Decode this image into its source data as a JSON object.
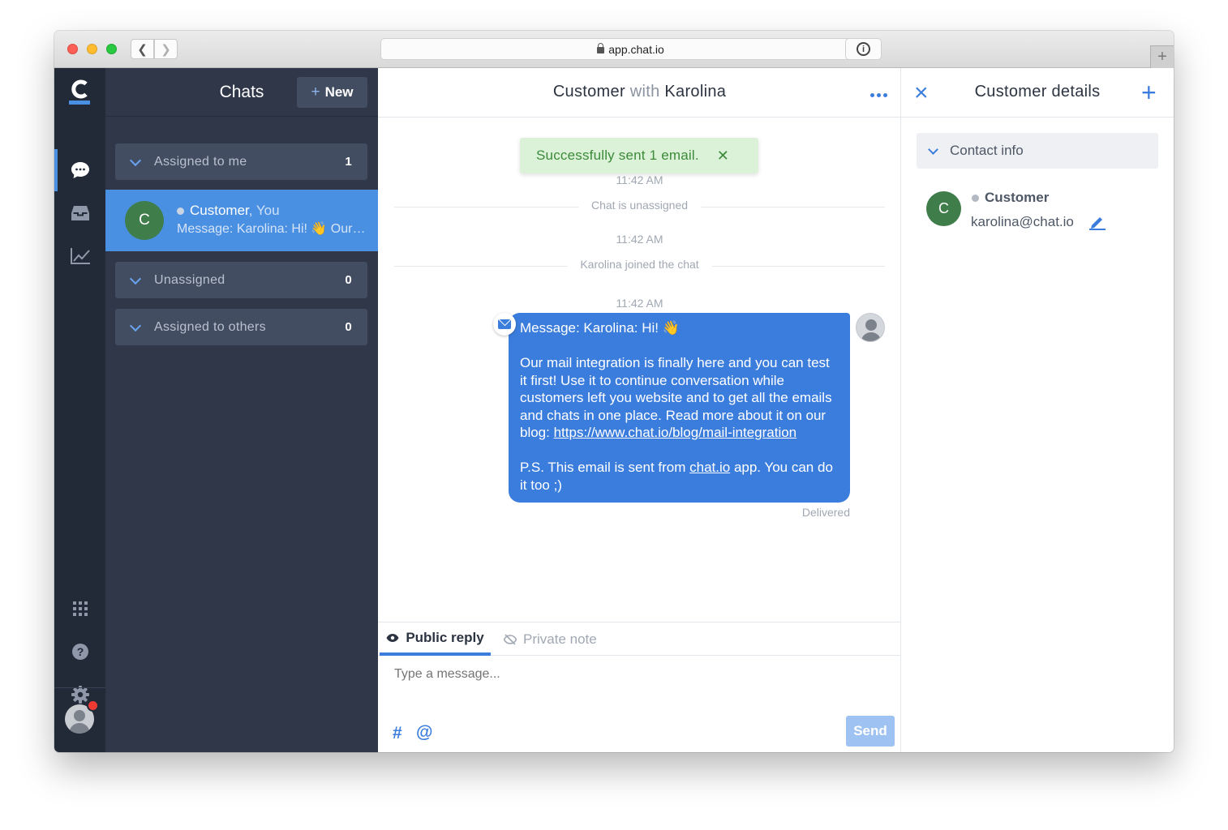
{
  "browser": {
    "url": "app.chat.io",
    "icons": [
      "back-icon",
      "forward-icon",
      "lock-icon",
      "reload-icon",
      "info-icon",
      "new-tab-icon"
    ]
  },
  "rail": {
    "items": [
      {
        "name": "chats",
        "icon": "chat-bubble-icon",
        "active": true
      },
      {
        "name": "archive",
        "icon": "inbox-icon",
        "active": false
      },
      {
        "name": "reports",
        "icon": "chart-line-icon",
        "active": false
      },
      {
        "name": "apps",
        "icon": "grid-icon",
        "active": false
      },
      {
        "name": "help",
        "icon": "question-icon",
        "active": false
      },
      {
        "name": "settings",
        "icon": "gear-icon",
        "active": false
      }
    ]
  },
  "chats_panel": {
    "title": "Chats",
    "new_button": "New",
    "groups": [
      {
        "label": "Assigned to me",
        "count": "1"
      },
      {
        "label": "Unassigned",
        "count": "0"
      },
      {
        "label": "Assigned to others",
        "count": "0"
      }
    ],
    "active_chat": {
      "avatar_initial": "C",
      "name": "Customer",
      "participants_suffix": ", You",
      "preview": "Message: Karolina: Hi! 👋 Our mail integration is finally here"
    }
  },
  "conversation": {
    "title_customer": "Customer",
    "title_with": "with",
    "title_agent": "Karolina",
    "toast": "Successfully sent 1 email.",
    "events": [
      {
        "time": "11:42 AM",
        "text": "Chat is unassigned"
      },
      {
        "time": "11:42 AM",
        "text": "Karolina joined the chat"
      },
      {
        "time": "11:42 AM"
      }
    ],
    "message": {
      "line1": "Message: Karolina: Hi! 👋",
      "paragraph": "Our mail integration is finally here and you can test it first! Use it to continue conversation while customers left you website and to get all the emails and chats in one place. Read more about it on our blog: ",
      "link": "https://www.chat.io/blog/mail-integration",
      "ps_before": "P.S. This email is sent from ",
      "ps_link": "chat.io",
      "ps_after": " app. You can do it too ;)",
      "status": "Delivered"
    },
    "composer": {
      "tab_public": "Public reply",
      "tab_private": "Private note",
      "placeholder": "Type a message...",
      "hash": "#",
      "at": "@",
      "send": "Send"
    }
  },
  "details": {
    "title": "Customer details",
    "section": "Contact info",
    "customer_initial": "C",
    "customer_name": "Customer",
    "customer_email": "karolina@chat.io"
  },
  "colors": {
    "accent": "#3b7ddd",
    "rail_bg": "#222a38",
    "panel_bg": "#2f3748",
    "active_chat": "#4a90e2",
    "success_bg": "#dcf2d8",
    "avatar_green": "#3f7d4b"
  }
}
